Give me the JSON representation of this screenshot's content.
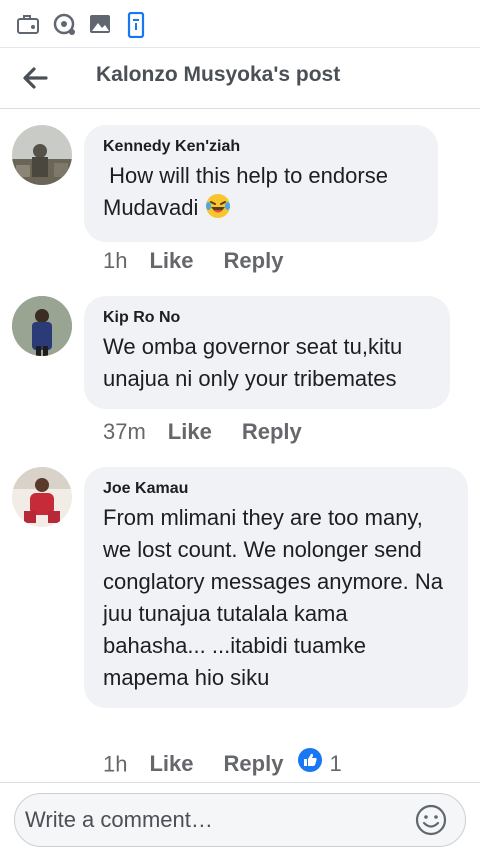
{
  "status_bar": {
    "icons": [
      "briefcase-icon",
      "cast-icon",
      "gallery-icon",
      "phone-icon"
    ]
  },
  "header": {
    "title": "Kalonzo Musyoka's post",
    "back_icon": "arrow-left-icon"
  },
  "comments": [
    {
      "author": "Kennedy Ken'ziah",
      "text": " How will this help to endorse Mudavadi",
      "emoji": "laughing-tears-emoji",
      "time": "1h",
      "like_label": "Like",
      "reply_label": "Reply"
    },
    {
      "author": "Kip Ro No",
      "text": "We omba governor seat tu,kitu unajua ni only your tribemates",
      "time": "37m",
      "like_label": "Like",
      "reply_label": "Reply"
    },
    {
      "author": "Joe Kamau",
      "text": "From mlimani they are too many, we lost count.  We nolonger send conglatory messages anymore. Na juu tunajua tutalala kama bahasha... ...itabidi tuamke mapema hio siku",
      "time": "1h",
      "like_label": "Like",
      "reply_label": "Reply",
      "reaction_icon": "like-reaction-icon",
      "reaction_count": "1"
    }
  ],
  "composer": {
    "placeholder": "Write a comment…",
    "emoji_icon": "smiley-icon"
  },
  "colors": {
    "bubble": "#f0f2f5",
    "secondary_text": "#65676b",
    "accent_blue": "#1877f2"
  }
}
